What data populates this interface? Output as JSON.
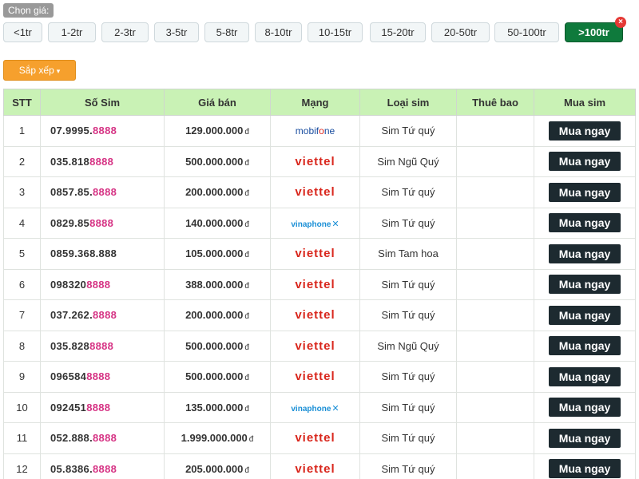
{
  "filter": {
    "label": "Chọn giá:",
    "options": [
      {
        "label": "<1tr",
        "active": false
      },
      {
        "label": "1-2tr",
        "active": false
      },
      {
        "label": "2-3tr",
        "active": false
      },
      {
        "label": "3-5tr",
        "active": false
      },
      {
        "label": "5-8tr",
        "active": false
      },
      {
        "label": "8-10tr",
        "active": false
      },
      {
        "label": "10-15tr",
        "active": false
      },
      {
        "label": "15-20tr",
        "active": false
      },
      {
        "label": "20-50tr",
        "active": false
      },
      {
        "label": "50-100tr",
        "active": false
      },
      {
        "label": ">100tr",
        "active": true
      }
    ],
    "close_icon": "close-icon",
    "close_glyph": "×"
  },
  "sort": {
    "label": "Sắp xếp",
    "caret": "▾"
  },
  "table": {
    "headers": [
      "STT",
      "Số Sim",
      "Giá bán",
      "Mạng",
      "Loại sim",
      "Thuê bao",
      "Mua sim"
    ],
    "currency": "đ",
    "buy_label": "Mua ngay",
    "rows": [
      {
        "stt": "1",
        "sim_head": "07.9995.",
        "sim_tail": "8888",
        "price": "129.000.000",
        "network": "mobifone",
        "type": "Sim Tứ quý",
        "subscriber": ""
      },
      {
        "stt": "2",
        "sim_head": "035.818",
        "sim_tail": "8888",
        "price": "500.000.000",
        "network": "viettel",
        "type": "Sim Ngũ Quý",
        "subscriber": ""
      },
      {
        "stt": "3",
        "sim_head": "0857.85.",
        "sim_tail": "8888",
        "price": "200.000.000",
        "network": "viettel",
        "type": "Sim Tứ quý",
        "subscriber": ""
      },
      {
        "stt": "4",
        "sim_head": "0829.85",
        "sim_tail": "8888",
        "price": "140.000.000",
        "network": "vinaphone",
        "type": "Sim Tứ quý",
        "subscriber": ""
      },
      {
        "stt": "5",
        "sim_head": "0859.368.888",
        "sim_tail": "",
        "price": "105.000.000",
        "network": "viettel",
        "type": "Sim Tam hoa",
        "subscriber": ""
      },
      {
        "stt": "6",
        "sim_head": "098320",
        "sim_tail": "8888",
        "price": "388.000.000",
        "network": "viettel",
        "type": "Sim Tứ quý",
        "subscriber": ""
      },
      {
        "stt": "7",
        "sim_head": "037.262.",
        "sim_tail": "8888",
        "price": "200.000.000",
        "network": "viettel",
        "type": "Sim Tứ quý",
        "subscriber": ""
      },
      {
        "stt": "8",
        "sim_head": "035.828",
        "sim_tail": "8888",
        "price": "500.000.000",
        "network": "viettel",
        "type": "Sim Ngũ Quý",
        "subscriber": ""
      },
      {
        "stt": "9",
        "sim_head": "096584",
        "sim_tail": "8888",
        "price": "500.000.000",
        "network": "viettel",
        "type": "Sim Tứ quý",
        "subscriber": ""
      },
      {
        "stt": "10",
        "sim_head": "092451",
        "sim_tail": "8888",
        "price": "135.000.000",
        "network": "vinaphone",
        "type": "Sim Tứ quý",
        "subscriber": ""
      },
      {
        "stt": "11",
        "sim_head": "052.888.",
        "sim_tail": "8888",
        "price": "1.999.000.000",
        "network": "viettel",
        "type": "Sim Tứ quý",
        "subscriber": ""
      },
      {
        "stt": "12",
        "sim_head": "05.8386.",
        "sim_tail": "8888",
        "price": "205.000.000",
        "network": "viettel",
        "type": "Sim Tứ quý",
        "subscriber": ""
      }
    ]
  },
  "network_logos": {
    "mobifone": {
      "text_a": "mobif",
      "text_b": "o",
      "text_c": "ne"
    },
    "viettel": {
      "text": "viettel"
    },
    "vinaphone": {
      "text": "vinaphone",
      "mark": "✕"
    }
  },
  "colors": {
    "header_bg": "#c9f2b5",
    "active_filter": "#0f7a3c",
    "sort_button": "#f6a02d",
    "buy_button": "#1d2a30",
    "sim_number": "#2c3f8c",
    "sim_tail": "#d63384",
    "viettel": "#d9261c",
    "mobifone": "#1a4ea0",
    "vinaphone": "#1a8fd6"
  }
}
